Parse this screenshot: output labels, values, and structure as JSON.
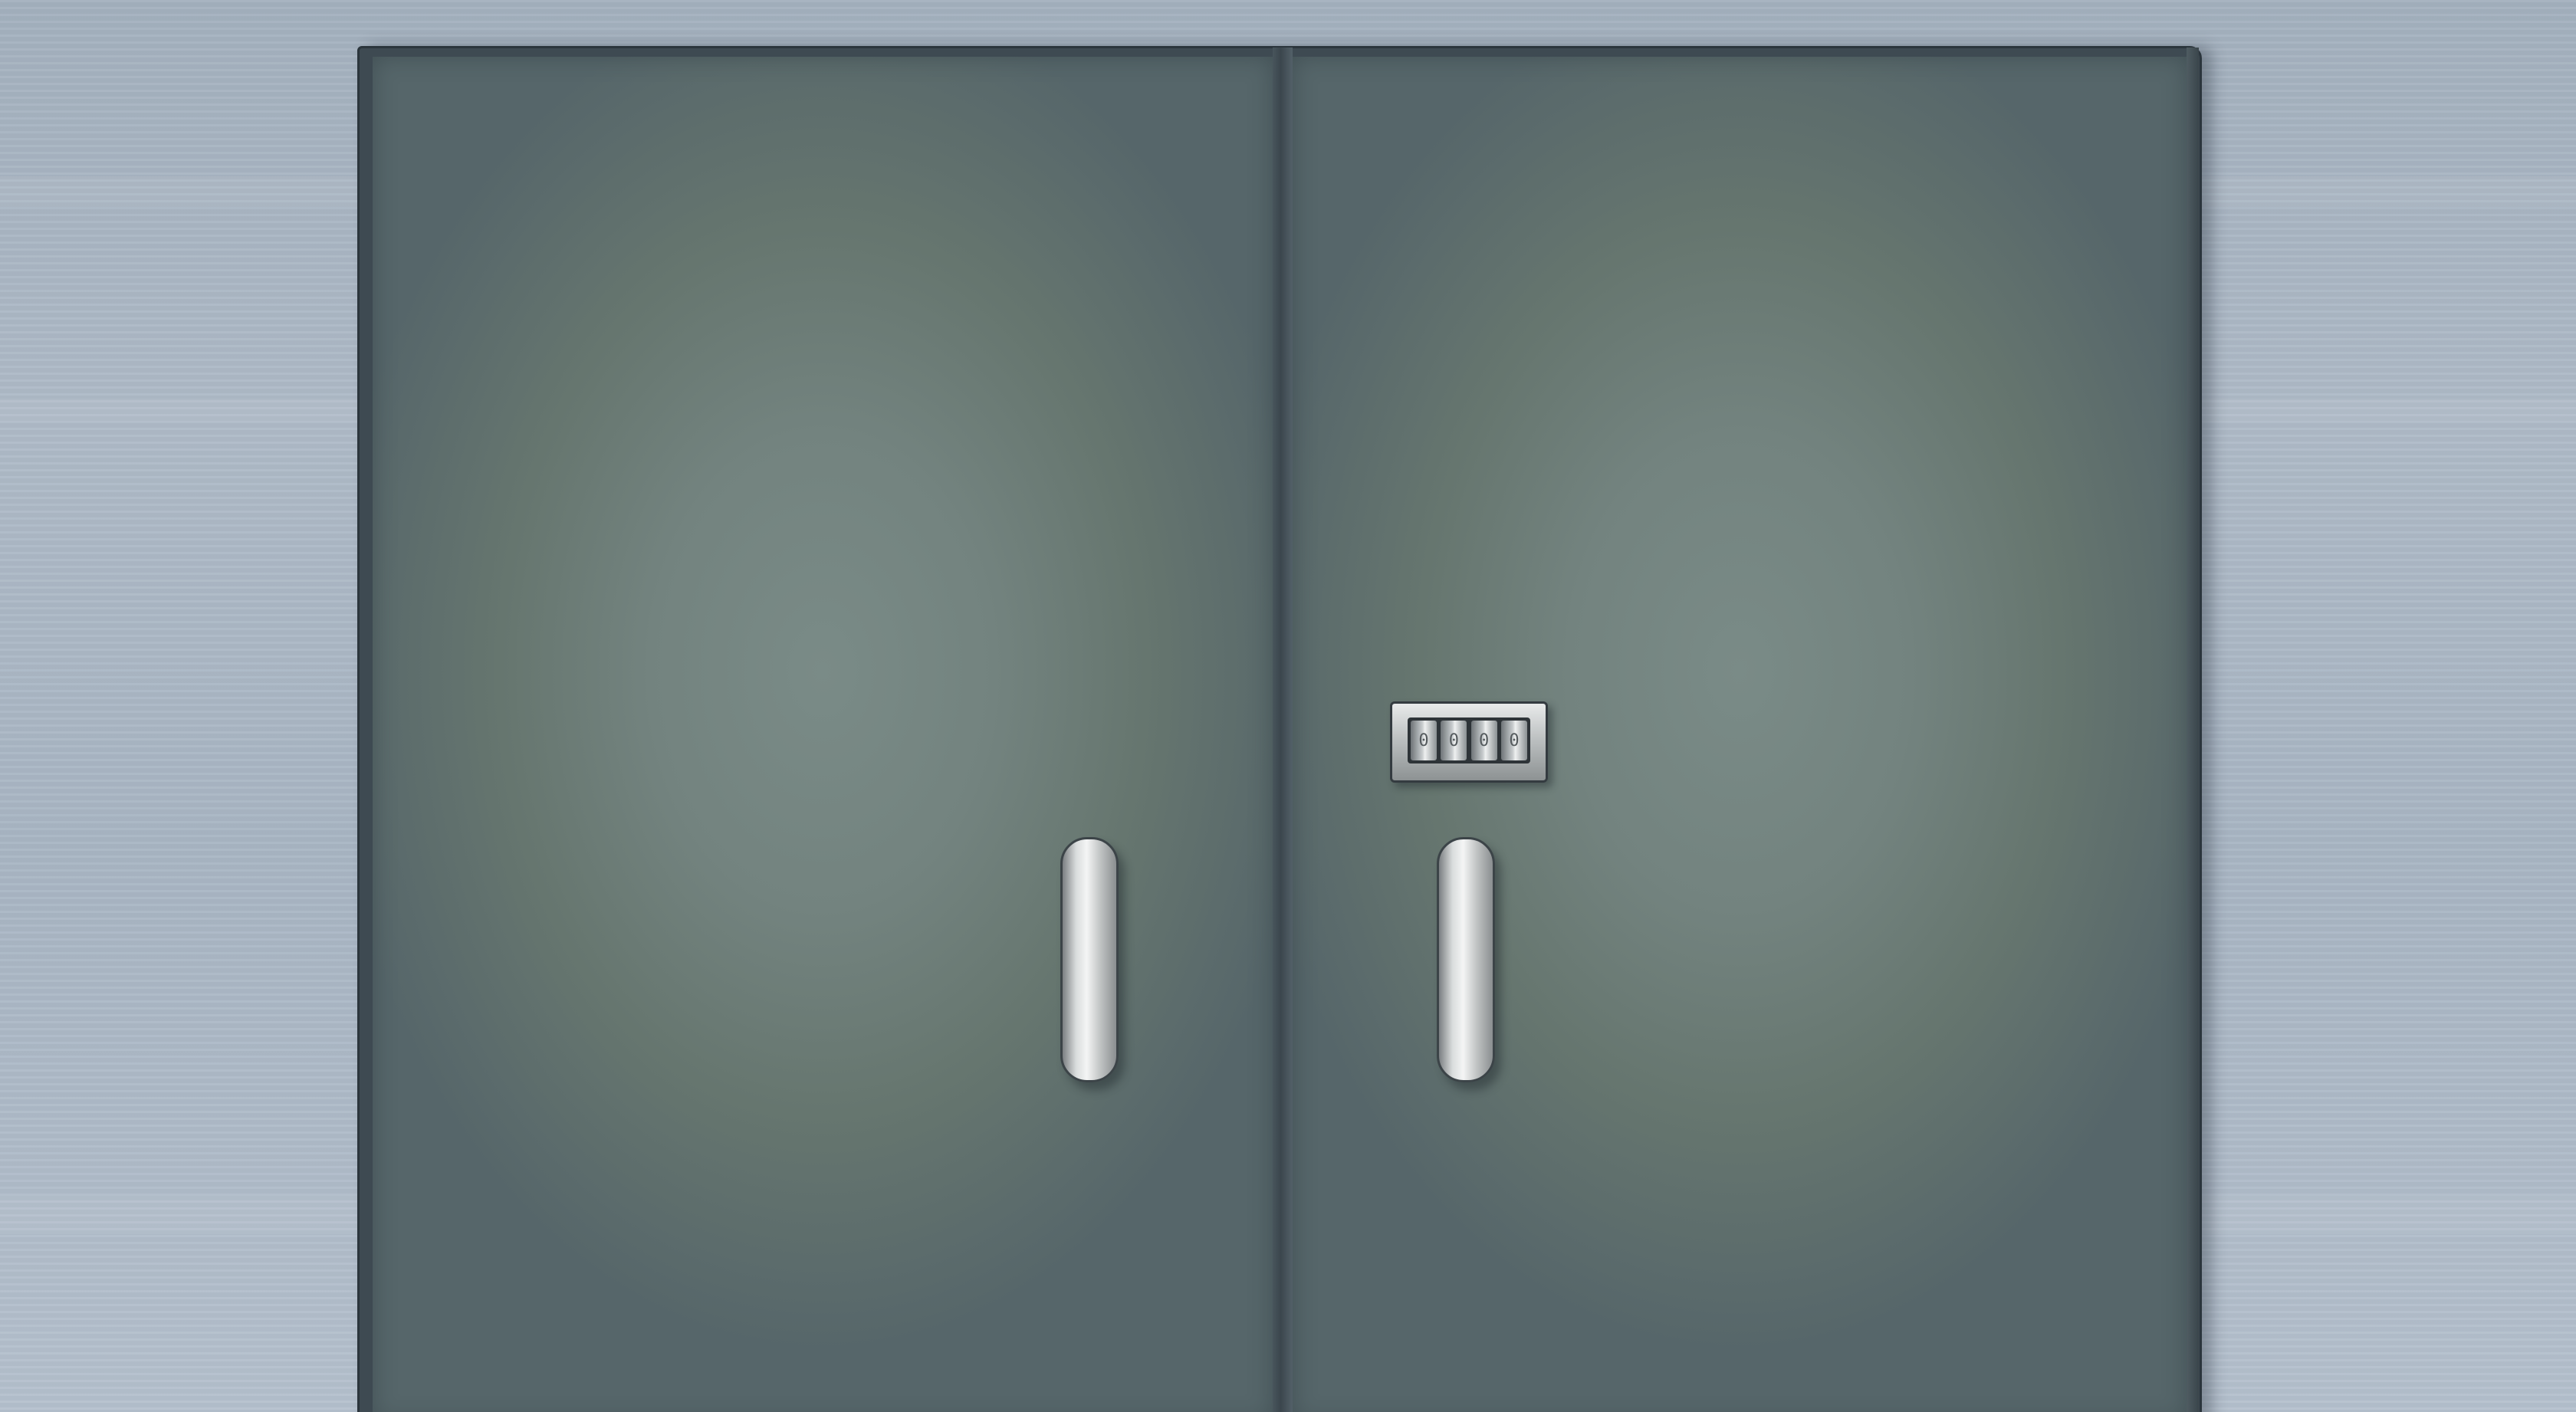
{
  "scene": {
    "description_type": "escape-room double door",
    "wall_color": "#a9b6c4",
    "door_color": "#73837f",
    "frame_color": "#3e4a52"
  },
  "combination_lock": {
    "dials": [
      "0",
      "0",
      "0",
      "0"
    ]
  },
  "icons": {
    "left_handle": "door-handle-icon",
    "right_handle": "door-handle-icon"
  }
}
